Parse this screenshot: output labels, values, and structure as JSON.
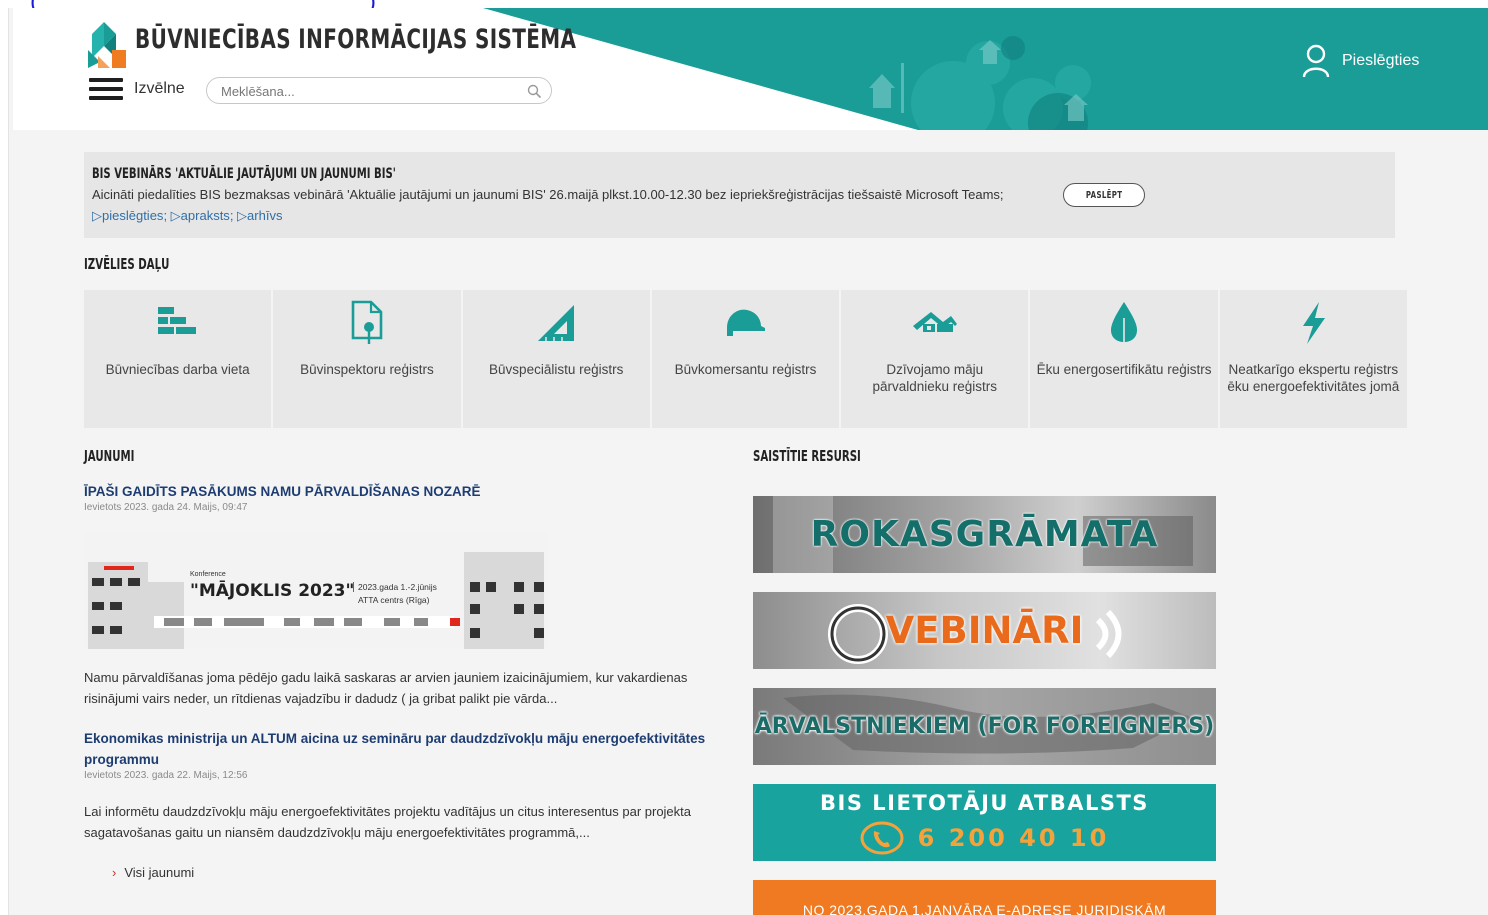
{
  "header": {
    "site_title": "BŪVNIECĪBAS INFORMĀCIJAS SISTĒMA",
    "menu_label": "Izvēlne",
    "search_placeholder": "Meklēšana...",
    "login_label": "Pieslēgties",
    "brand_teal": "#1a9c97"
  },
  "notice": {
    "title": "BIS VEBINĀRS 'AKTUĀLIE JAUTĀJUMI UN JAUNUMI BIS'",
    "text": "Aicināti piedalīties BIS bezmaksas vebinārā 'Aktuālie jautājumi un jaunumi BIS' 26.maijā plkst.10.00-12.30 bez iepriekšreģistrācijas tiešsaistē Microsoft Teams;",
    "links": [
      "▷pieslēgties",
      "▷apraksts",
      "▷arhīvs"
    ],
    "hide_label": "PASLĒPT"
  },
  "sections": {
    "choose_title": "IZVĒLIES DAĻU",
    "news_title": "JAUNUMI",
    "resources_title": "SAISTĪTIE RESURSI"
  },
  "tiles": [
    {
      "label": "Būvniecības darba vieta",
      "icon": "bricks-icon"
    },
    {
      "label": "Būvinspektoru reģistrs",
      "icon": "document-inspector-icon"
    },
    {
      "label": "Būvspeciālistu reģistrs",
      "icon": "set-square-icon"
    },
    {
      "label": "Būvkomersantu reģistrs",
      "icon": "hard-hat-icon"
    },
    {
      "label": "Dzīvojamo māju pārvaldnieku reģistrs",
      "icon": "house-roof-icon"
    },
    {
      "label": "Ēku energosertifikātu reģistrs",
      "icon": "leaf-drop-icon"
    },
    {
      "label": "Neatkarīgo ekspertu reģistrs ēku energoefektivitātes jomā",
      "icon": "lightning-icon"
    }
  ],
  "news": [
    {
      "title": "ĪPAŠI GAIDĪTS PASĀKUMS NAMU PĀRVALDĪŠANAS NOZARĒ",
      "date": "Ievietots 2023. gada 24. Maijs, 09:47",
      "image": {
        "kicker": "Konference",
        "headline": "\"MĀJOKLIS 2023\"",
        "date_line": "2023.gada 1.-2.jūnijs",
        "venue_line": "ATTA centrs (Rīga)"
      },
      "body": "Namu pārvaldīšanas joma pēdējo gadu laikā saskaras ar arvien jauniem izaicinājumiem, kur vakardienas risinājumi vairs neder, un rītdienas vajadzību ir dadudz ( ja gribat palikt pie vārda..."
    },
    {
      "title": "Ekonomikas ministrija un ALTUM aicina uz semināru par daudzdzīvokļu māju energoefektivitātes programmu",
      "date": "Ievietots 2023. gada 22. Maijs, 12:56",
      "body": "Lai informētu daudzdzīvokļu māju energoefektivitātes projektu vadītājus un citus interesentus par projekta sagatavošanas gaitu un niansēm daudzdzīvokļu māju energoefektivitātes programmā,..."
    }
  ],
  "all_news_label": "Visi jaunumi",
  "banners": [
    {
      "text": "ROKASGRĀMATA"
    },
    {
      "text": "VEBINĀRI"
    },
    {
      "text": "ĀRVALSTNIEKIEM (FOR FOREIGNERS)"
    },
    {
      "text": "BIS LIETOTĀJU ATBALSTS",
      "phone": "6 200 40 10"
    },
    {
      "text": "NO 2023.GADA 1.JANVĀRA E-ADRESE JURIDISKĀM"
    }
  ],
  "top_clip_text": "(____________________)"
}
